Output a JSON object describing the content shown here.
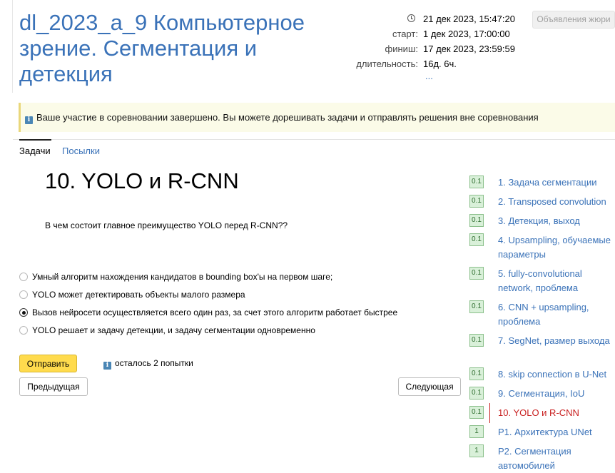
{
  "contest": {
    "title": "dl_2023_a_9 Компьютерное зрение. Сегментация и детекция",
    "now": "21 дек 2023, 15:47:20",
    "start_label": "старт:",
    "start": "1 дек 2023, 17:00:00",
    "finish_label": "финиш:",
    "finish": "17 дек 2023, 23:59:59",
    "duration_label": "длительность:",
    "duration": "16д. 6ч.",
    "more": "...",
    "jury_button": "Объявления жюри"
  },
  "notice": {
    "icon": "info-icon",
    "text": "Ваше участие в соревновании завершено. Вы можете дорешивать задачи и отправлять решения вне соревнования"
  },
  "tabs": [
    {
      "label": "Задачи",
      "active": true
    },
    {
      "label": "Посылки",
      "active": false
    }
  ],
  "problem": {
    "title": "10. YOLO и R-CNN",
    "question": "В чем состоит главное преимущество YOLO перед R-CNN??",
    "options": [
      {
        "label": "Умный алгоритм нахождения кандидатов в bounding box'ы на первом шаге;",
        "selected": false
      },
      {
        "label": "YOLO может детектировать объекты малого размера",
        "selected": false
      },
      {
        "label": "Вызов нейросети осуществляется всего один раз, за счет этого алгоритм работает быстрее",
        "selected": true
      },
      {
        "label": "YOLO решает и задачу детекции, и задачу сегментации одновременно",
        "selected": false
      }
    ],
    "submit": "Отправить",
    "attempts": "осталось 2 попытки",
    "prev": "Предыдущая",
    "next": "Следующая"
  },
  "sidebar": {
    "items": [
      {
        "score": "0.1",
        "label": "1. Задача сегментации"
      },
      {
        "score": "0.1",
        "label": "2. Transposed convolution"
      },
      {
        "score": "0.1",
        "label": "3. Детекция, выход"
      },
      {
        "score": "0.1",
        "label": "4. Upsampling, обучаемые параметры"
      },
      {
        "score": "0.1",
        "label": "5. fully-convolutional network, проблема"
      },
      {
        "score": "0.1",
        "label": "6. CNN + upsampling, проблема"
      },
      {
        "score": "0.1",
        "label": "7. SegNet, размер выхода"
      },
      {
        "score": "0.1",
        "label": "8. skip connection в U-Net"
      },
      {
        "score": "0.1",
        "label": "9. Сегментация, IoU"
      },
      {
        "score": "0.1",
        "label": "10. YOLO и R-CNN",
        "active": true
      },
      {
        "score": "1",
        "label": "P1. Архитектура UNet"
      },
      {
        "score": "1",
        "label": "P2. Сегментация автомобилей"
      }
    ]
  },
  "colors": {
    "link": "#3a72b8",
    "active": "#c81e1e",
    "badge_bg": "#d9f0d9",
    "submit_bg": "#ffdb4d",
    "notice_bg": "#fbfbe8"
  }
}
